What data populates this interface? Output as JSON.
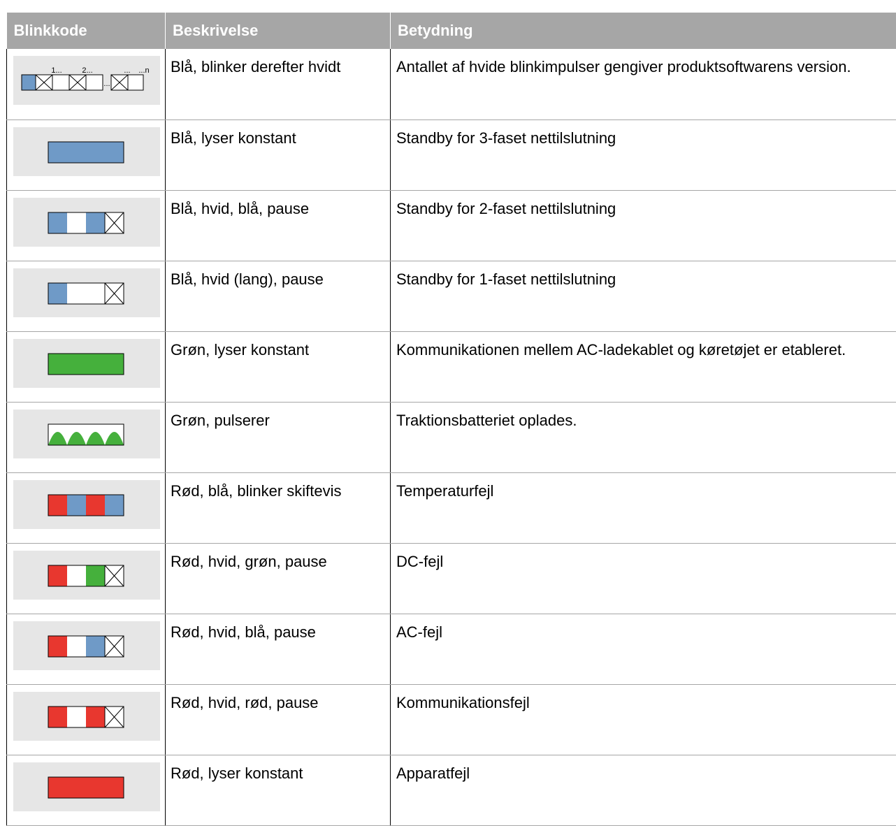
{
  "header": {
    "col1": "Blinkkode",
    "col2": "Beskrivelse",
    "col3": "Betydning"
  },
  "colors": {
    "blue": "#6f9ac7",
    "white": "#ffffff",
    "green": "#45b03c",
    "red": "#e8372f",
    "header_bg": "#a6a6a6",
    "code_bg": "#e6e6e6"
  },
  "rows": [
    {
      "pattern": [
        "blue",
        "pause",
        "white",
        "pause",
        "white",
        "ellipsis",
        "pause",
        "white"
      ],
      "pattern_labels": [
        "1...",
        "2...",
        "...",
        "...n"
      ],
      "description": "Blå, blinker derefter hvidt",
      "meaning": "Antallet af hvide blinkimpulser gengiver produktsoftwarens version."
    },
    {
      "pattern": [
        "blue-solid"
      ],
      "description": "Blå, lyser konstant",
      "meaning": "Standby for 3-faset nettilslutning"
    },
    {
      "pattern": [
        "blue",
        "white",
        "blue",
        "pause"
      ],
      "description": "Blå, hvid, blå, pause",
      "meaning": "Standby for 2-faset nettilslutning"
    },
    {
      "pattern": [
        "blue",
        "white-long",
        "pause"
      ],
      "description": "Blå, hvid (lang), pause",
      "meaning": "Standby for 1-faset nettilslutning"
    },
    {
      "pattern": [
        "green-solid"
      ],
      "description": "Grøn, lyser konstant",
      "meaning": "Kommunikationen mellem AC-ladekablet og køretøjet er etableret."
    },
    {
      "pattern": [
        "green-pulse"
      ],
      "description": "Grøn, pulserer",
      "meaning": "Traktionsbatteriet oplades."
    },
    {
      "pattern": [
        "red",
        "blue",
        "red",
        "blue"
      ],
      "description": "Rød, blå, blinker skiftevis",
      "meaning": "Temperaturfejl"
    },
    {
      "pattern": [
        "red",
        "white",
        "green",
        "pause"
      ],
      "description": "Rød, hvid, grøn, pause",
      "meaning": "DC-fejl"
    },
    {
      "pattern": [
        "red",
        "white",
        "blue",
        "pause"
      ],
      "description": "Rød, hvid, blå, pause",
      "meaning": "AC-fejl"
    },
    {
      "pattern": [
        "red",
        "white",
        "red",
        "pause"
      ],
      "description": "Rød, hvid, rød, pause",
      "meaning": "Kommunikationsfejl"
    },
    {
      "pattern": [
        "red-solid"
      ],
      "description": "Rød, lyser konstant",
      "meaning": "Apparatfejl"
    }
  ]
}
